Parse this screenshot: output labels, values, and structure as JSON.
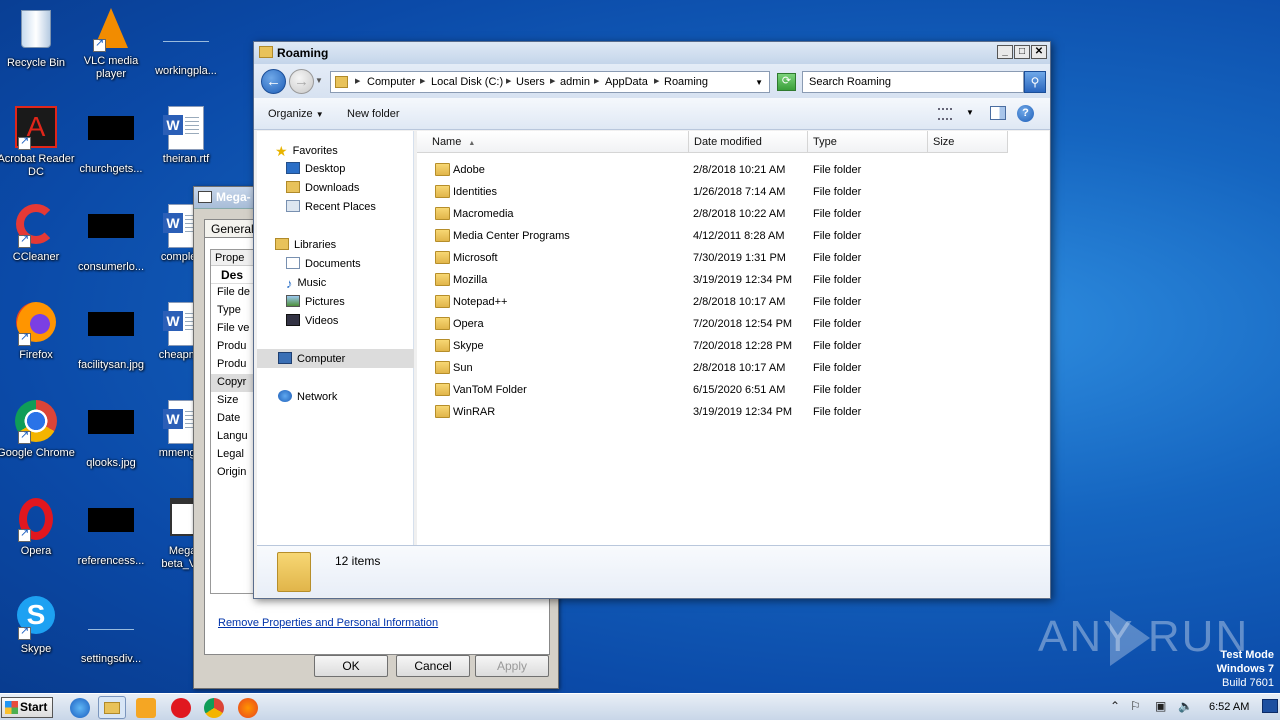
{
  "desktop_icons": [
    {
      "label": "Recycle Bin"
    },
    {
      "label": "VLC media player"
    },
    {
      "label": "workingpla..."
    },
    {
      "label": "Acrobat Reader DC"
    },
    {
      "label": "churchgets..."
    },
    {
      "label": "theiran.rtf"
    },
    {
      "label": "CCleaner"
    },
    {
      "label": "consumerlo..."
    },
    {
      "label": "complex..."
    },
    {
      "label": "Firefox"
    },
    {
      "label": "facilitysan.jpg"
    },
    {
      "label": "cheapmu..."
    },
    {
      "label": "Google Chrome"
    },
    {
      "label": "qlooks.jpg"
    },
    {
      "label": "mmengla..."
    },
    {
      "label": "Opera"
    },
    {
      "label": "referencess..."
    },
    {
      "label": "Mega-I beta_Va..."
    },
    {
      "label": "Skype"
    },
    {
      "label": "settingsdiv..."
    }
  ],
  "properties_dialog": {
    "title": "Mega-",
    "tab_general": "General",
    "header_prop": "Prope",
    "header_desc": "Des",
    "rows": [
      "File de",
      "Type",
      "File ve",
      "Produ",
      "Produ",
      "Copyr",
      "Size",
      "Date",
      "Langu",
      "Legal",
      "Origin"
    ],
    "remove_link": "Remove Properties and Personal Information",
    "ok": "OK",
    "cancel": "Cancel",
    "apply": "Apply"
  },
  "explorer": {
    "title": "Roaming",
    "breadcrumbs": [
      "Computer",
      "Local Disk (C:)",
      "Users",
      "admin",
      "AppData",
      "Roaming"
    ],
    "search_placeholder": "Search Roaming",
    "toolbar": {
      "organize": "Organize",
      "new_folder": "New folder"
    },
    "nav": {
      "favorites": "Favorites",
      "desktop": "Desktop",
      "downloads": "Downloads",
      "recent_places": "Recent Places",
      "libraries": "Libraries",
      "documents": "Documents",
      "music": "Music",
      "pictures": "Pictures",
      "videos": "Videos",
      "computer": "Computer",
      "network": "Network"
    },
    "columns": {
      "name": "Name",
      "date": "Date modified",
      "type": "Type",
      "size": "Size"
    },
    "files": [
      {
        "name": "Adobe",
        "date": "2/8/2018 10:21 AM",
        "type": "File folder"
      },
      {
        "name": "Identities",
        "date": "1/26/2018 7:14 AM",
        "type": "File folder"
      },
      {
        "name": "Macromedia",
        "date": "2/8/2018 10:22 AM",
        "type": "File folder"
      },
      {
        "name": "Media Center Programs",
        "date": "4/12/2011 8:28 AM",
        "type": "File folder"
      },
      {
        "name": "Microsoft",
        "date": "7/30/2019 1:31 PM",
        "type": "File folder"
      },
      {
        "name": "Mozilla",
        "date": "3/19/2019 12:34 PM",
        "type": "File folder"
      },
      {
        "name": "Notepad++",
        "date": "2/8/2018 10:17 AM",
        "type": "File folder"
      },
      {
        "name": "Opera",
        "date": "7/20/2018 12:54 PM",
        "type": "File folder"
      },
      {
        "name": "Skype",
        "date": "7/20/2018 12:28 PM",
        "type": "File folder"
      },
      {
        "name": "Sun",
        "date": "2/8/2018 10:17 AM",
        "type": "File folder"
      },
      {
        "name": "VanToM Folder",
        "date": "6/15/2020 6:51 AM",
        "type": "File folder"
      },
      {
        "name": "WinRAR",
        "date": "3/19/2019 12:34 PM",
        "type": "File folder"
      }
    ],
    "item_count": "12 items"
  },
  "taskbar": {
    "start": "Start",
    "clock": "6:52 AM"
  },
  "watermark": {
    "brand": "ANY RUN",
    "test_mode": "Test Mode",
    "os": "Windows 7",
    "build": "Build 7601"
  }
}
